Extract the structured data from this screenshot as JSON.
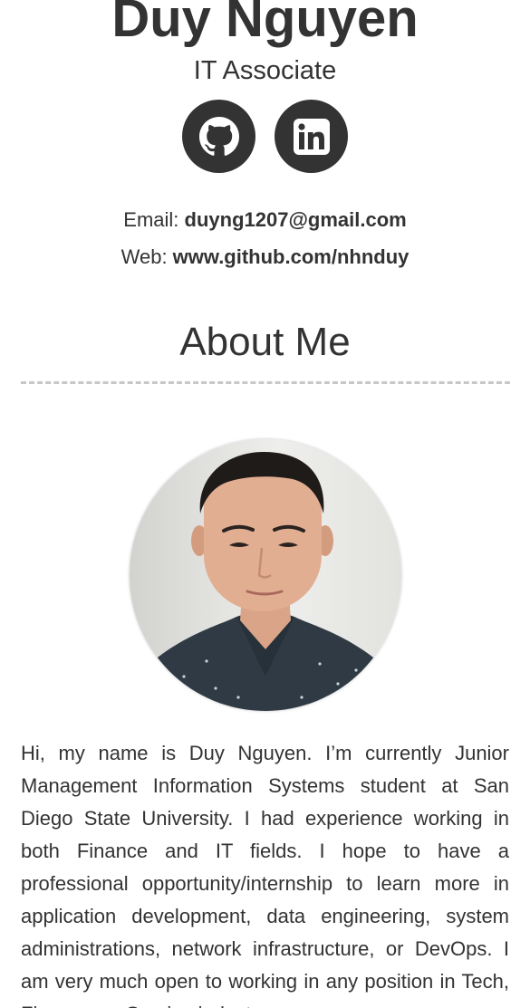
{
  "header": {
    "name": "Duy Nguyen",
    "role": "IT Associate"
  },
  "social": {
    "github_icon": "github-icon",
    "linkedin_icon": "linkedin-icon"
  },
  "contact": {
    "email_label": "Email: ",
    "email_value": "duyng1207@gmail.com",
    "web_label": "Web: ",
    "web_value": "www.github.com/nhnduy"
  },
  "about": {
    "title": "About Me",
    "bio": "Hi, my name is Duy Nguyen. I’m currently Junior Management Information Systems student at San Diego State University. I had experience working in both Finance and IT fields. I hope to have a professional opportunity/internship to learn more in application development, data engineering, system administrations, network infrastructure, or DevOps. I am very much open to working in any position in Tech, Finance, or Service industry."
  },
  "colors": {
    "text": "#333333",
    "icon_bg": "#333333",
    "divider": "#c8c8c8"
  }
}
